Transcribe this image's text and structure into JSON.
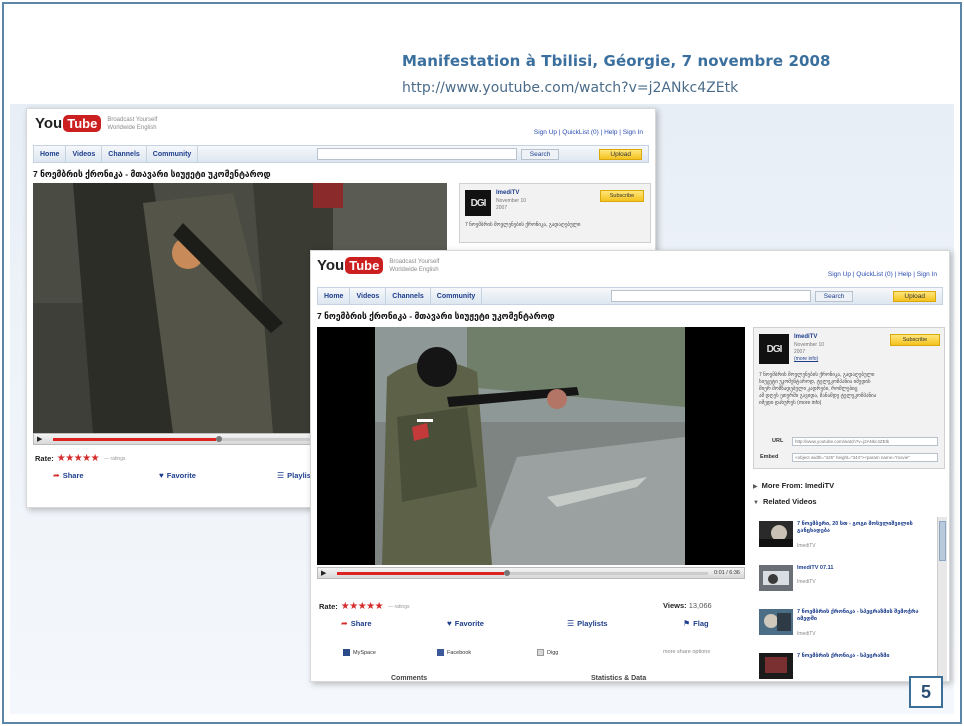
{
  "slide": {
    "title": "Manifestation à Tbilisi, Géorgie, 7 novembre 2008",
    "url": "http://www.youtube.com/watch?v=j2ANkc4ZEtk",
    "page_number": "5"
  },
  "youtube": {
    "logo_you": "You",
    "logo_tube": "Tube",
    "region_line1": "Broadcast Yourself",
    "region_line2": "Worldwide  English",
    "toplinks": "Sign Up  |  QuickList (0)  |  Help  |  Sign In",
    "nav": {
      "home": "Home",
      "videos": "Videos",
      "channels": "Channels",
      "community": "Community",
      "search_button": "Search",
      "upload_button": "Upload"
    },
    "video_title": "7 ნოემბრის ქრონიკა - მთავარი სიუჟეტი უკომენტაროდ",
    "channel": {
      "name": "ImediTV",
      "date": "November 10",
      "count": "2007",
      "more_link": "(more info)",
      "subscribe": "Subscribe",
      "avatar_text": "DGI"
    },
    "description_lines": [
      "7 ნოემბრის მოვლენების ქრონიკა, გადაღებული",
      "სიუჟეტი უკომენტაროდ, ტელეკომპანია იმედის",
      "მიერ მომზადებული კადრები, რომლებიც",
      "ამ დღეს ეთერში გავიდა, მანამდე ტელეკომპანია",
      "იმედი დახურეს (more info)"
    ],
    "url_label": "URL",
    "url_value": "http://www.youtube.com/watch?v=j2ANkc4ZEtk",
    "embed_label": "Embed",
    "embed_value": "<object width=\"425\" height=\"344\"><param name=\"movie\"",
    "rate_label": "Rate:",
    "stars": "★★★★★",
    "ratings_count": "— ratings",
    "views_label": "Views:",
    "views_value": "13,066",
    "time": "0:01 / 6:36",
    "actions": {
      "share": "Share",
      "favorite": "Favorite",
      "playlists": "Playlists",
      "flag": "Flag"
    },
    "share_row": {
      "myspace": "MySpace",
      "facebook": "Facebook",
      "digg": "Digg",
      "more": "more share options"
    },
    "more_from": "More From: ImediTV",
    "related_videos": "Related Videos",
    "related": [
      {
        "title": "7 ნოემბერი, 20 სთ - გოგი მოსულიშვილის განცხადება",
        "meta": "ImediTV"
      },
      {
        "title": "ImediTV 07.11",
        "meta": "ImediTV"
      },
      {
        "title": "7 ნოემბრის ქრონიკა - სპეცრაზმის შემოჭრა იმედში",
        "meta": "ImediTV"
      },
      {
        "title": "7 ნოემბრის ქრონიკა - სპეცრაზმი",
        "meta": "ImediTV"
      }
    ],
    "comments_label": "Comments",
    "stats_label": "Statistics & Data"
  },
  "colors": {
    "accent_blue": "#3a6f9e",
    "youtube_red": "#cc1f1f",
    "star_red": "#d42b2b",
    "link_blue": "#1d3e8c",
    "upload_yellow": "#f4c21f"
  },
  "icons": [
    "play-icon",
    "share-icon",
    "favorite-icon",
    "playlists-icon",
    "flag-icon",
    "myspace-icon",
    "facebook-icon",
    "digg-icon",
    "triangle-icon"
  ]
}
